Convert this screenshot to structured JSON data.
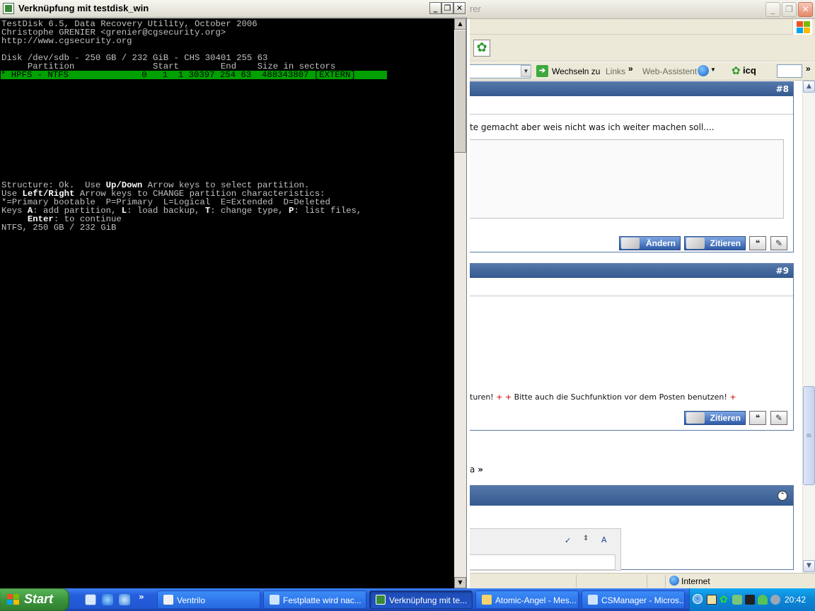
{
  "ie": {
    "title_fragment": "rer",
    "toolbar": {
      "go_label": "Wechseln zu",
      "links_label": "Links",
      "web_assistant": "Web-Assistent",
      "icq_label": "icq"
    },
    "posts": [
      {
        "number": "#8",
        "text": "te gemacht aber weis nicht was ich weiter machen soll....",
        "buttons": [
          "Ändern",
          "Zitieren"
        ]
      },
      {
        "number": "#9",
        "signature_start": "turen!",
        "signature_mid": "Bitte auch die Suchfunktion vor dem Posten benutzen!",
        "buttons": [
          "Zitieren"
        ]
      }
    ],
    "nav_text": "a",
    "status_zone": "Internet"
  },
  "console": {
    "title": "Verknüpfung mit testdisk_win",
    "lines": {
      "l1": "TestDisk 6.5, Data Recovery Utility, October 2006",
      "l2": "Christophe GRENIER <grenier@cgsecurity.org>",
      "l3": "http://www.cgsecurity.org",
      "l4": "Disk /dev/sdb - 250 GB / 232 GiB - CHS 30401 255 63",
      "l5": "     Partition               Start        End    Size in sectors",
      "l6": "* HPFS - NTFS              0   1  1 30397 254 63  488343807 [EXTERN]",
      "s1_a": "Structure: Ok.  Use ",
      "s1_b": "Up/Down",
      "s1_c": " Arrow keys to select partition.",
      "s2_a": "Use ",
      "s2_b": "Left/Right",
      "s2_c": " Arrow keys to CHANGE partition characteristics:",
      "s3": "*=Primary bootable  P=Primary  L=Logical  E=Extended  D=Deleted",
      "s4_a": "Keys ",
      "s4_b": "A",
      "s4_c": ": add partition, ",
      "s4_d": "L",
      "s4_e": ": load backup, ",
      "s4_f": "T",
      "s4_g": ": change type, ",
      "s4_h": "P",
      "s4_i": ": list files,",
      "s5_a": "     ",
      "s5_b": "Enter",
      "s5_c": ": to continue",
      "s6": "NTFS, 250 GB / 232 GiB"
    }
  },
  "taskbar": {
    "start_label": "Start",
    "tasks": [
      {
        "label": "Ventrilo"
      },
      {
        "label": "Festplatte wird nac..."
      },
      {
        "label": "Verknüpfung mit te..."
      },
      {
        "label": "Atomic-Angel - Mes..."
      },
      {
        "label": "CSManager - Micros..."
      }
    ],
    "clock": "20:42"
  }
}
